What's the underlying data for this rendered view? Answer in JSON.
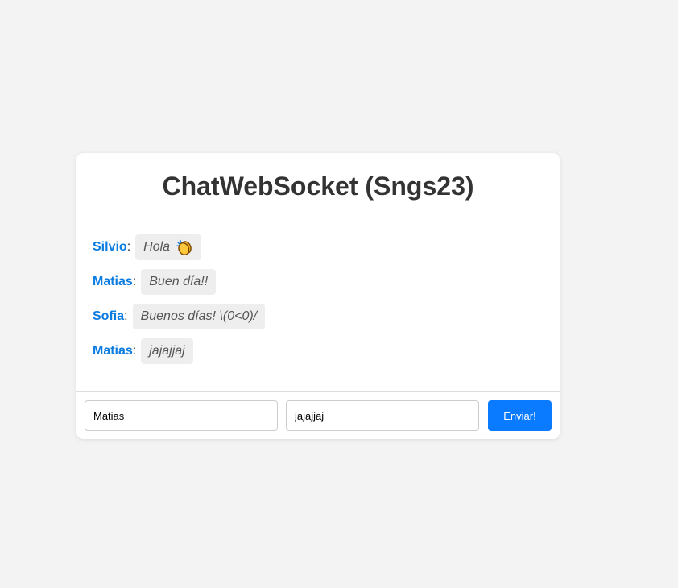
{
  "app": {
    "title": "ChatWebSocket (Sngs23)"
  },
  "messages": [
    {
      "user": "Silvio",
      "text": "Hola",
      "emoji_icon": "clapping-hands-icon"
    },
    {
      "user": "Matias",
      "text": "Buen día!!"
    },
    {
      "user": "Sofia",
      "text": "Buenos días! \\(0<0)/"
    },
    {
      "user": "Matias",
      "text": "jajajjaj"
    }
  ],
  "form": {
    "name_value": "Matias",
    "message_value": "jajajjaj",
    "send_label": "Enviar!"
  },
  "colors": {
    "username": "#0a7be0",
    "button": "#0a7bff",
    "bubble": "#eeeeee",
    "background": "#f3f3f3"
  }
}
